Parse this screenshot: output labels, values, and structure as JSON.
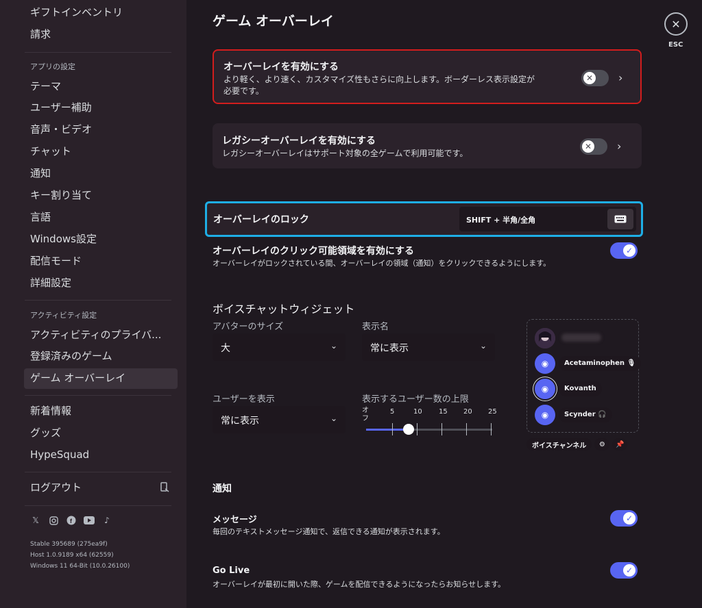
{
  "sidebar": {
    "items_top": [
      "ギフトインベントリ",
      "請求"
    ],
    "app_header": "アプリの設定",
    "app_items": [
      "テーマ",
      "ユーザー補助",
      "音声・ビデオ",
      "チャット",
      "通知",
      "キー割り当て",
      "言語",
      "Windows設定",
      "配信モード",
      "詳細設定"
    ],
    "activity_header": "アクティビティ設定",
    "activity_items": [
      "アクティビティのプライバ...",
      "登録済みのゲーム",
      "ゲーム オーバーレイ"
    ],
    "other_items": [
      "新着情報",
      "グッズ",
      "HypeSquad"
    ],
    "logout": "ログアウト",
    "version_lines": [
      "Stable 395689 (275ea9f)",
      "Host 1.0.9189 x64 (62559)",
      "Windows 11 64-Bit (10.0.26100)"
    ]
  },
  "main": {
    "title": "ゲーム オーバーレイ",
    "enable_overlay": {
      "title": "オーバーレイを有効にする",
      "desc_line1": "より軽く、より速く、カスタマイズ性もさらに向上します。ボーダーレス表示設定が",
      "desc_line2": "必要です。"
    },
    "legacy_overlay": {
      "title": "レガシーオーバーレイを有効にする",
      "desc": "レガシーオーバーレイはサポート対象の全ゲームで利用可能です。"
    },
    "lock": {
      "title": "オーバーレイのロック",
      "keybind": "SHIFT + 半角/全角"
    },
    "clickable": {
      "title": "オーバーレイのクリック可能領域を有効にする",
      "desc": "オーバーレイがロックされている間、オーバーレイの領域（通知）をクリックできるようにします。"
    },
    "voice_widget": {
      "heading": "ボイスチャットウィジェット",
      "avatar_size_label": "アバターのサイズ",
      "avatar_size_value": "大",
      "display_name_label": "表示名",
      "display_name_value": "常に表示",
      "show_users_label": "ユーザーを表示",
      "show_users_value": "常に表示",
      "user_limit_label": "表示するユーザー数の上限",
      "slider_ticks": [
        "オフ",
        "5",
        "10",
        "15",
        "20",
        "25"
      ],
      "slider_value": 10,
      "preview_users": [
        "Acetaminophen",
        "Kovanth",
        "Scynder"
      ],
      "voice_channel_chip": "ボイスチャンネル"
    },
    "notifications": {
      "heading": "通知",
      "message_title": "メッセージ",
      "message_desc": "毎回のテキストメッセージ通知で、返信できる通知が表示されます。",
      "golive_title": "Go Live",
      "golive_desc": "オーバーレイが最初に開いた際、ゲームを配信できるようになったらお知らせします。"
    }
  },
  "esc": {
    "label": "ESC"
  },
  "colors": {
    "accent": "#5865f2",
    "highlight_red": "#d21d1d",
    "highlight_blue": "#1eaee6"
  }
}
